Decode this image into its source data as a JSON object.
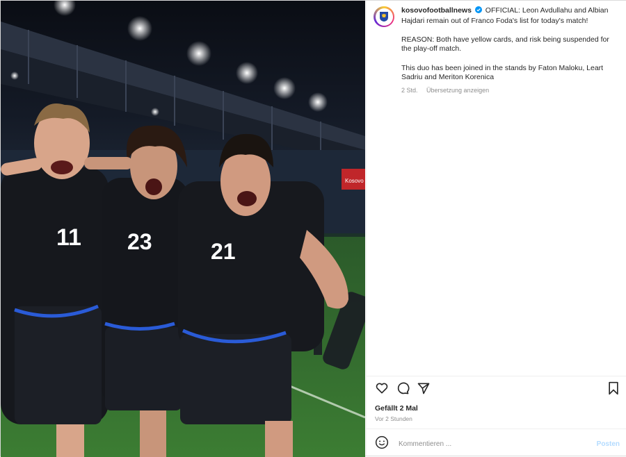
{
  "post": {
    "username": "kosovofootballnews",
    "caption_lines": [
      "OFFICIAL: Leon Avdullahu and Albian Hajdari remain out of Franco Foda's list for today's match!",
      "REASON: Both have yellow cards, and risk being suspended for the play-off match.",
      "This duo has been joined in the stands by Faton Maloku, Leart Sadriu and Meriton Korenica"
    ],
    "age": "2 Std.",
    "translate_label": "Übersetzung anzeigen",
    "likes_text": "Gefällt 2 Mal",
    "timestamp": "Vor 2 Stunden"
  },
  "photo": {
    "jersey_numbers": [
      "11",
      "23",
      "21"
    ],
    "scoreboard": "Kosovo"
  },
  "comment": {
    "placeholder": "Kommentieren ...",
    "post_label": "Posten"
  },
  "icons": {
    "verified": "verified-badge-icon",
    "like": "heart-icon",
    "comment": "comment-icon",
    "share": "share-icon",
    "save": "bookmark-icon",
    "emoji": "emoji-icon"
  },
  "colors": {
    "verified_blue": "#0095f6",
    "post_button": "#b3dbff",
    "jersey": "#16181d",
    "jersey_trim": "#2a5bd7",
    "pitch": "#2f6a2c"
  }
}
